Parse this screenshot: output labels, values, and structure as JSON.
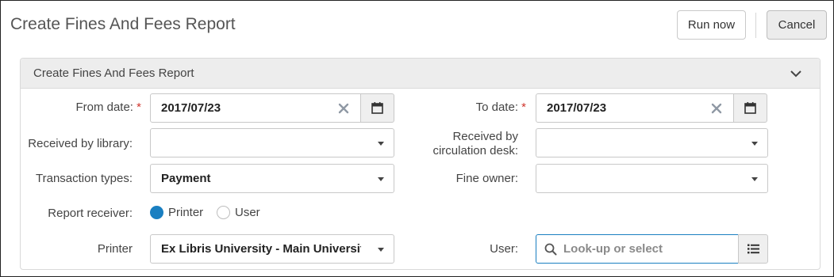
{
  "header": {
    "title": "Create Fines And Fees Report",
    "run_now_label": "Run now",
    "cancel_label": "Cancel"
  },
  "panel": {
    "title": "Create Fines And Fees Report"
  },
  "form": {
    "from_date": {
      "label": "From date:",
      "required_mark": "*",
      "value": "2017/07/23"
    },
    "to_date": {
      "label": "To date:",
      "required_mark": "*",
      "value": "2017/07/23"
    },
    "received_by_library": {
      "label": "Received by library:",
      "value": ""
    },
    "received_by_desk": {
      "label_line1": "Received by",
      "label_line2": "circulation desk:",
      "value": ""
    },
    "transaction_types": {
      "label": "Transaction types:",
      "value": "Payment"
    },
    "fine_owner": {
      "label": "Fine owner:",
      "value": ""
    },
    "report_receiver": {
      "label": "Report receiver:",
      "options": [
        {
          "label": "Printer",
          "selected": true
        },
        {
          "label": "User",
          "selected": false
        }
      ]
    },
    "printer": {
      "label": "Printer",
      "value": "Ex Libris University - Main University"
    },
    "user": {
      "label": "User:",
      "placeholder": "Look-up or select"
    }
  },
  "icons": {
    "clear": "close-icon",
    "calendar": "calendar-icon",
    "caret": "caret-down-icon",
    "search": "search-icon",
    "list": "list-icon",
    "collapse": "chevron-down-icon"
  },
  "colors": {
    "accent": "#1a7fc1",
    "required": "#d0342c",
    "panel_header": "#ededed"
  }
}
